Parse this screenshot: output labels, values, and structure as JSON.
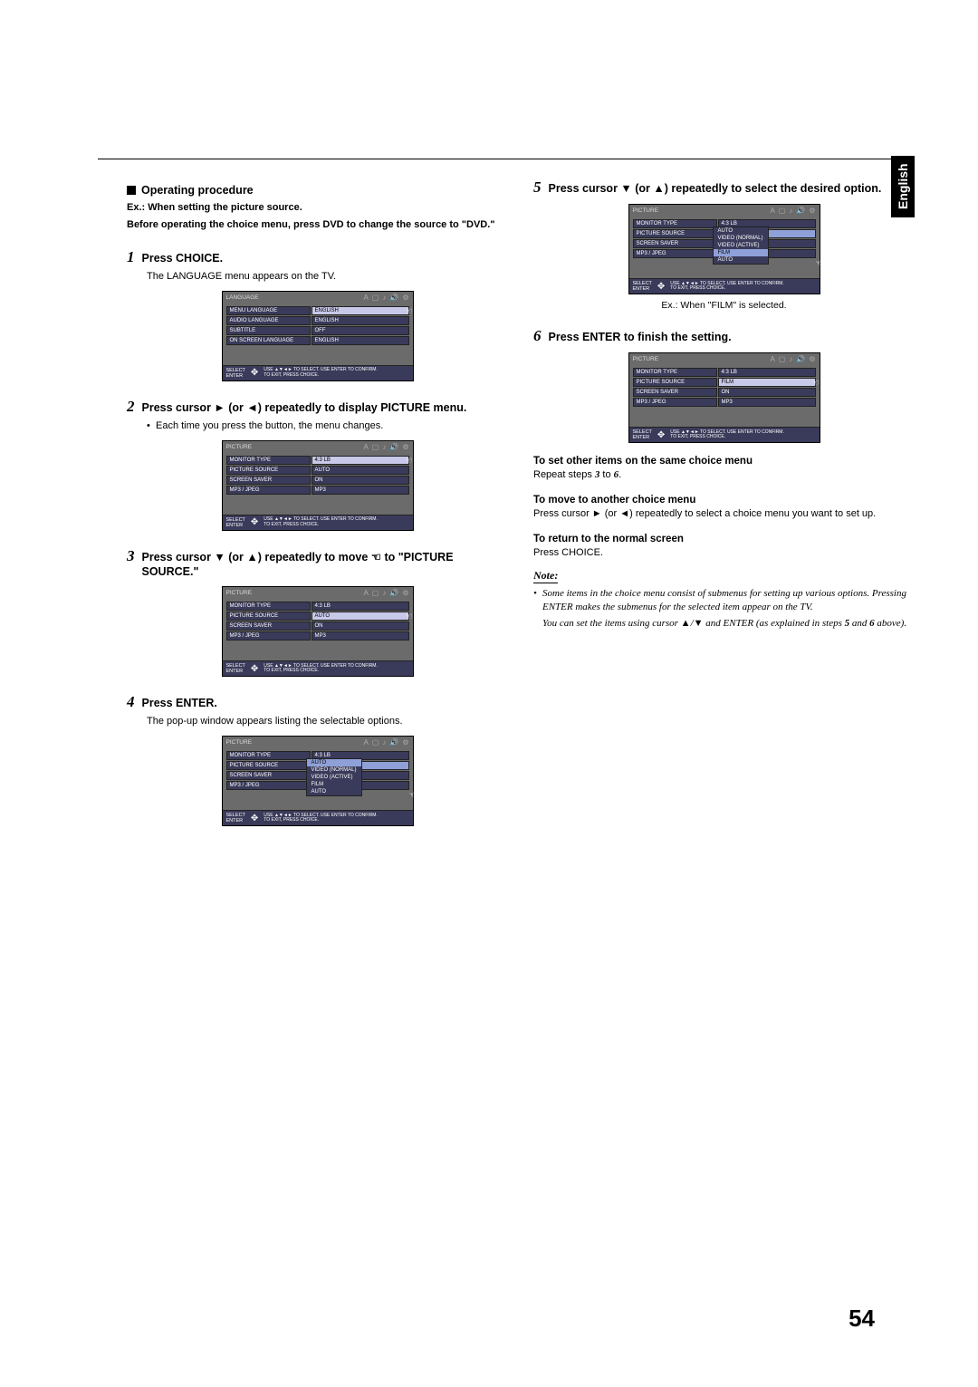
{
  "lang_tab": "English",
  "page_number": "54",
  "left": {
    "section_title": "Operating procedure",
    "example_line": "Ex.: When setting the picture source.",
    "preface": "Before operating the choice menu, press DVD to change the source to \"DVD.\"",
    "step1": {
      "num": "1",
      "title": "Press CHOICE.",
      "body": "The LANGUAGE menu appears on the TV."
    },
    "step2": {
      "num": "2",
      "title": "Press cursor ► (or ◄) repeatedly to display PICTURE menu.",
      "bullet": "Each time you press the button, the menu changes."
    },
    "step3": {
      "num": "3",
      "title_a": "Press cursor ▼ (or ▲) repeatedly to move ",
      "title_b": " to \"PICTURE SOURCE.\""
    },
    "step4": {
      "num": "4",
      "title": "Press ENTER.",
      "body": "The pop-up window appears listing the selectable options."
    }
  },
  "right": {
    "step5": {
      "num": "5",
      "title": "Press cursor ▼ (or ▲) repeatedly to select the desired option.",
      "caption": "Ex.: When \"FILM\" is selected."
    },
    "step6": {
      "num": "6",
      "title": "Press ENTER to finish the setting."
    },
    "sub1_title": "To set other items on the same choice menu",
    "sub1_body_a": "Repeat steps ",
    "sub1_body_b": "3",
    "sub1_body_c": " to ",
    "sub1_body_d": "6",
    "sub1_body_e": ".",
    "sub2_title": "To move to another choice menu",
    "sub2_body": "Press cursor ► (or ◄) repeatedly to select a choice menu you want to set up.",
    "sub3_title": "To return to the normal screen",
    "sub3_body": "Press CHOICE.",
    "note_label": "Note:",
    "note1": "Some items in the choice menu consist of submenus for setting up various options. Pressing ENTER makes the submenus for the selected item appear on the TV.",
    "note2_a": "You can set the items using cursor ▲/▼ and ENTER (as explained in steps ",
    "note2_b": "5",
    "note2_c": " and ",
    "note2_d": "6",
    "note2_e": " above)."
  },
  "osd": {
    "language": {
      "title": "LANGUAGE",
      "rows": [
        {
          "label": "MENU LANGUAGE",
          "value": "ENGLISH",
          "hl": true
        },
        {
          "label": "AUDIO LANGUAGE",
          "value": "ENGLISH"
        },
        {
          "label": "SUBTITLE",
          "value": "OFF"
        },
        {
          "label": "ON SCREEN LANGUAGE",
          "value": "ENGLISH"
        }
      ]
    },
    "picture": {
      "title": "PICTURE",
      "rows": [
        {
          "label": "MONITOR TYPE",
          "value": "4:3 LB"
        },
        {
          "label": "PICTURE SOURCE",
          "value": "AUTO"
        },
        {
          "label": "SCREEN SAVER",
          "value": "ON"
        },
        {
          "label": "MP3 / JPEG",
          "value": "MP3"
        }
      ]
    },
    "popup_options": [
      "AUTO",
      "VIDEO (NORMAL)",
      "VIDEO (ACTIVE)",
      "FILM",
      "AUTO"
    ],
    "footer": {
      "leftA": "SELECT",
      "leftB": "ENTER",
      "textA": "USE ▲▼◄► TO SELECT. USE ENTER TO CONFIRM.",
      "textB": "TO EXIT, PRESS CHOICE."
    }
  }
}
